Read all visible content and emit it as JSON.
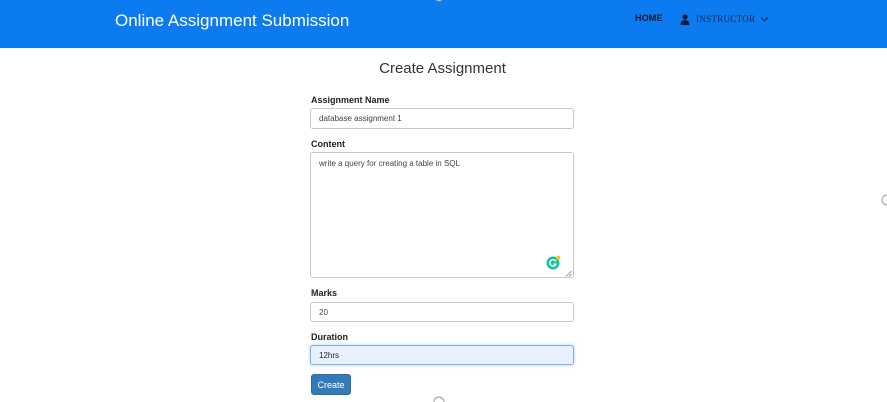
{
  "navbar": {
    "brand": "Online Assignment Submission",
    "home": "HOME",
    "user": "INSTRUCTOR"
  },
  "form": {
    "title": "Create Assignment",
    "name_label": "Assignment Name",
    "name_value": "database assignment 1",
    "content_label": "Content",
    "content_value": "write a query for creating a table in SQL",
    "marks_label": "Marks",
    "marks_value": "20",
    "duration_label": "Duration",
    "duration_value": "12hrs",
    "create_button": "Create"
  },
  "colors": {
    "navbar": "#0d7bf0",
    "button": "#337ab7",
    "focus_bg": "#e8f0fe"
  },
  "icons": [
    "user-icon",
    "chevron-down-icon",
    "grammarly-icon",
    "resize-handle-icon"
  ]
}
